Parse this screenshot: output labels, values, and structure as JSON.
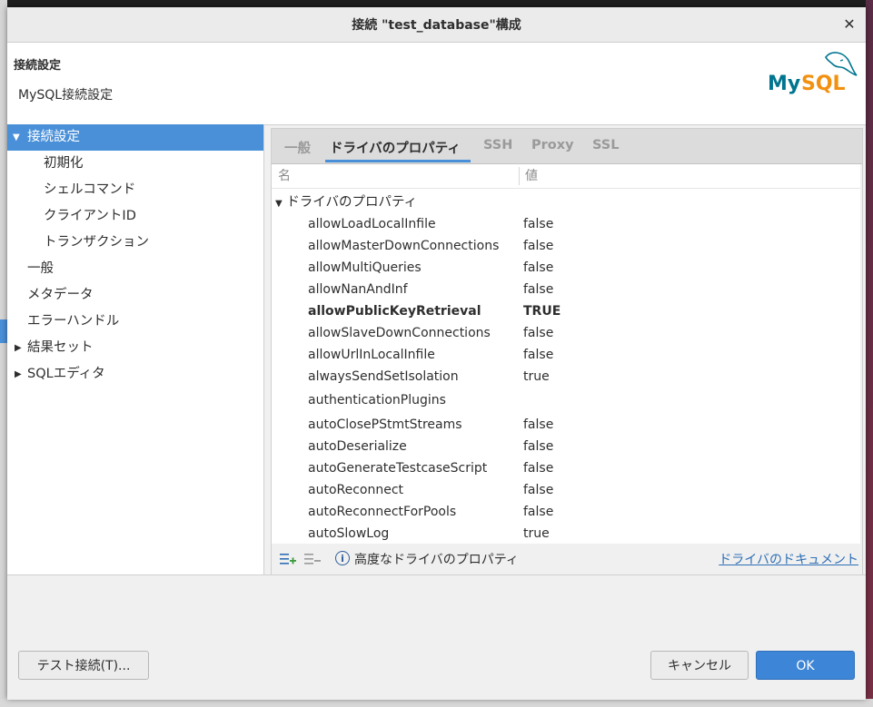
{
  "dialog": {
    "title": "接続 \"test_database\"構成",
    "close_glyph": "✕"
  },
  "header": {
    "title": "接続設定",
    "subtitle": "MySQL接続設定",
    "logo_text": "MySQL"
  },
  "nav": {
    "items": [
      {
        "label": "接続設定",
        "expanded": true
      },
      {
        "label": "初期化"
      },
      {
        "label": "シェルコマンド"
      },
      {
        "label": "クライアントID"
      },
      {
        "label": "トランザクション"
      },
      {
        "label": "一般"
      },
      {
        "label": "メタデータ"
      },
      {
        "label": "エラーハンドル"
      },
      {
        "label": "結果セット"
      },
      {
        "label": "SQLエディタ"
      }
    ]
  },
  "tabs": [
    {
      "label": "一般"
    },
    {
      "label": "ドライバのプロパティ",
      "active": true
    },
    {
      "label": "SSH"
    },
    {
      "label": "Proxy"
    },
    {
      "label": "SSL"
    }
  ],
  "table": {
    "col_name": "名",
    "col_value": "値",
    "group": "ドライバのプロパティ",
    "rows": [
      {
        "name": "allowLoadLocalInfile",
        "value": "false"
      },
      {
        "name": "allowMasterDownConnections",
        "value": "false"
      },
      {
        "name": "allowMultiQueries",
        "value": "false"
      },
      {
        "name": "allowNanAndInf",
        "value": "false"
      },
      {
        "name": "allowPublicKeyRetrieval",
        "value": "TRUE",
        "bold": true
      },
      {
        "name": "allowSlaveDownConnections",
        "value": "false"
      },
      {
        "name": "allowUrlInLocalInfile",
        "value": "false"
      },
      {
        "name": "alwaysSendSetIsolation",
        "value": "true"
      },
      {
        "name": "authenticationPlugins",
        "value": ""
      },
      {
        "name": "autoClosePStmtStreams",
        "value": "false"
      },
      {
        "name": "autoDeserialize",
        "value": "false"
      },
      {
        "name": "autoGenerateTestcaseScript",
        "value": "false"
      },
      {
        "name": "autoReconnect",
        "value": "false"
      },
      {
        "name": "autoReconnectForPools",
        "value": "false"
      },
      {
        "name": "autoSlowLog",
        "value": "true"
      }
    ]
  },
  "table_footer": {
    "advanced_label": "高度なドライバのプロパティ",
    "doc_link": "ドライバのドキュメント"
  },
  "buttons": {
    "test": "テスト接続(T)...",
    "cancel": "キャンセル",
    "ok": "OK"
  },
  "colors": {
    "accent": "#4a90d9",
    "mysql_blue": "#00758f",
    "mysql_orange": "#f29111"
  }
}
